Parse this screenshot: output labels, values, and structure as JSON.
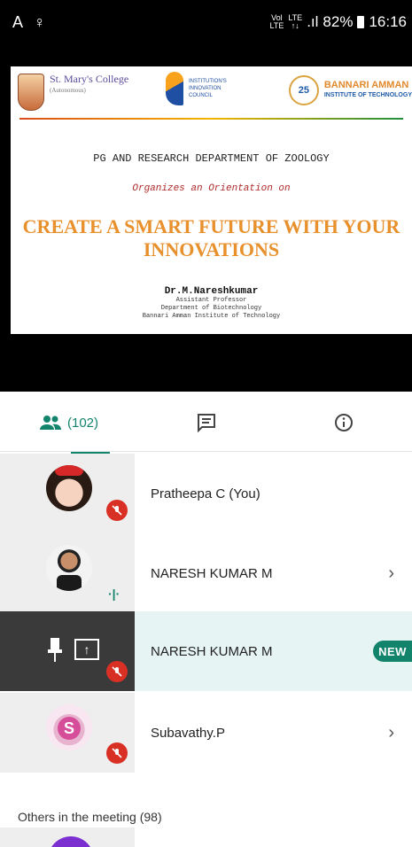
{
  "status_bar": {
    "left_icons": "A ♀",
    "net1": "Vol\nLTE",
    "net2": "LTE\n↑↓",
    "signal": ".ıl",
    "battery_percent": "82%",
    "time": "16:16"
  },
  "slide": {
    "college_name": "St. Mary's College",
    "college_sub": "(Autonomous)",
    "council_name": "INSTITUTION'S INNOVATION COUNCIL",
    "anniversary": "25",
    "partner_name": "BANNARI AMMAN",
    "partner_sub": "INSTITUTE OF TECHNOLOGY",
    "department": "PG AND RESEARCH DEPARTMENT OF ZOOLOGY",
    "organizes": "Organizes an Orientation on",
    "title": "CREATE A SMART FUTURE WITH YOUR INNOVATIONS",
    "speaker_name": "Dr.M.Nareshkumar",
    "speaker_role": "Assistant Professor",
    "speaker_dept": "Department of Biotechnology",
    "speaker_inst": "Bannari Amman Institute of Technology"
  },
  "tabs": {
    "people_count": "(102)",
    "people_icon": "people-icon",
    "chat_icon": "chat-icon",
    "info_icon": "info-icon",
    "accent": "#13846c"
  },
  "participants": [
    {
      "name": "Pratheepa C (You)",
      "muted": true
    },
    {
      "name": "NARESH KUMAR M",
      "muted": false,
      "speaking": true
    },
    {
      "name": "NARESH KUMAR M",
      "muted": true,
      "presenting": true,
      "badge": "NEW"
    },
    {
      "name": "Subavathy.P",
      "muted": true
    }
  ],
  "others_label": "Others in the meeting (98)"
}
